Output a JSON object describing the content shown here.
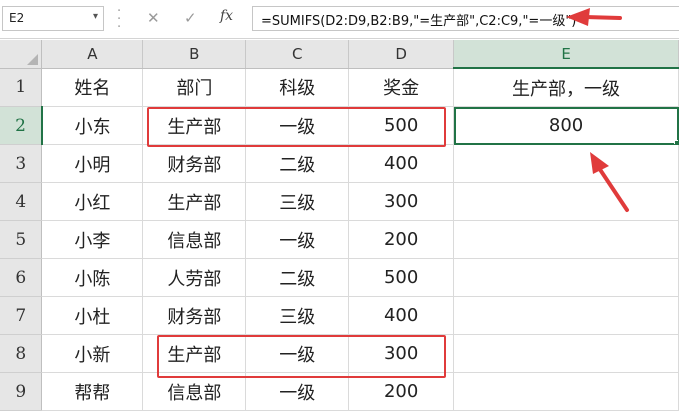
{
  "formula_bar": {
    "name_box": "E2",
    "cancel_icon": "✕",
    "confirm_icon": "✓",
    "fx_label": "fx",
    "formula": "=SUMIFS(D2:D9,B2:B9,\"=生产部\",C2:C9,\"=一级\")"
  },
  "sheet": {
    "columns": [
      "A",
      "B",
      "C",
      "D",
      "E"
    ],
    "rows": [
      {
        "num": "1",
        "cells": [
          "姓名",
          "部门",
          "科级",
          "奖金",
          "生产部，一级"
        ]
      },
      {
        "num": "2",
        "cells": [
          "小东",
          "生产部",
          "一级",
          "500",
          "800"
        ]
      },
      {
        "num": "3",
        "cells": [
          "小明",
          "财务部",
          "二级",
          "400",
          ""
        ]
      },
      {
        "num": "4",
        "cells": [
          "小红",
          "生产部",
          "三级",
          "300",
          ""
        ]
      },
      {
        "num": "5",
        "cells": [
          "小李",
          "信息部",
          "一级",
          "200",
          ""
        ]
      },
      {
        "num": "6",
        "cells": [
          "小陈",
          "人劳部",
          "二级",
          "500",
          ""
        ]
      },
      {
        "num": "7",
        "cells": [
          "小杜",
          "财务部",
          "三级",
          "400",
          ""
        ]
      },
      {
        "num": "8",
        "cells": [
          "小新",
          "生产部",
          "一级",
          "300",
          ""
        ]
      },
      {
        "num": "9",
        "cells": [
          "帮帮",
          "信息部",
          "一级",
          "200",
          ""
        ]
      }
    ],
    "active_cell": "E2"
  },
  "annotation_color": "#e03b3b",
  "accent_color": "#217346"
}
